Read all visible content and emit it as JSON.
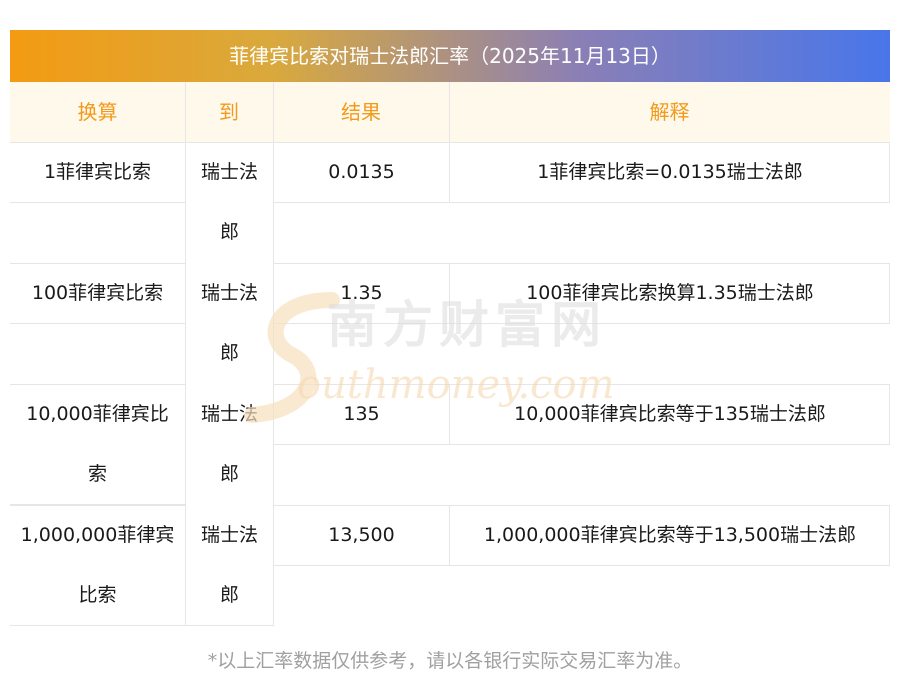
{
  "title": "菲律宾比索对瑞士法郎汇率（2025年11月13日）",
  "headers": {
    "col1": "换算",
    "col2": "到",
    "col3": "结果",
    "col4": "解释"
  },
  "rows": [
    {
      "amount_lines": [
        "1菲律宾比索"
      ],
      "to_lines": [
        "瑞士法",
        "郎"
      ],
      "result": "0.0135",
      "explain": "1菲律宾比索=0.0135瑞士法郎"
    },
    {
      "amount_lines": [
        "100菲律宾比索"
      ],
      "to_lines": [
        "瑞士法",
        "郎"
      ],
      "result": "1.35",
      "explain": "100菲律宾比索换算1.35瑞士法郎"
    },
    {
      "amount_lines": [
        "10,000菲律宾比",
        "索"
      ],
      "to_lines": [
        "瑞士法",
        "郎"
      ],
      "result": "135",
      "explain": "10,000菲律宾比索等于135瑞士法郎"
    },
    {
      "amount_lines": [
        "1,000,000菲律宾",
        "比索"
      ],
      "to_lines": [
        "瑞士法",
        "郎"
      ],
      "result": "13,500",
      "explain": "1,000,000菲律宾比索等于13,500瑞士法郎"
    }
  ],
  "footnote": "*以上汇率数据仅供参考，请以各银行实际交易汇率为准。",
  "watermark": {
    "cn": "南方财富网",
    "en": "outhmoney.com",
    "icon": "S-swoosh-logo"
  },
  "colors": {
    "header_text": "#f39a1c",
    "header_bg": "#fff9ec",
    "banner_start": "#f39b12",
    "banner_end": "#4876ea"
  }
}
